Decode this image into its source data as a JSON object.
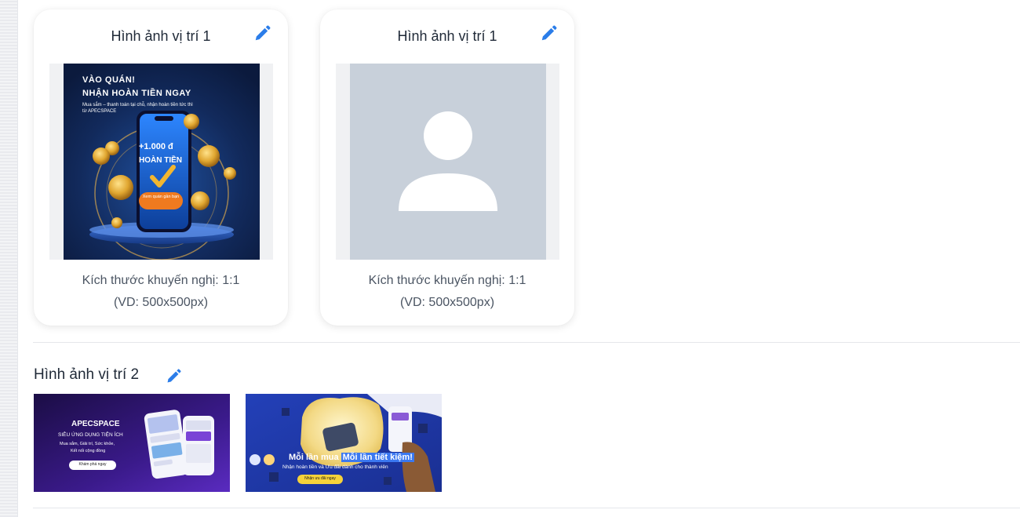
{
  "cards": [
    {
      "title": "Hình ảnh vị trí 1",
      "hint_line1": "Kích thước khuyến nghị: 1:1",
      "hint_line2": "(VD: 500x500px)",
      "image": {
        "kind": "promo",
        "headline1": "VÀO QUÁN!",
        "headline2": "NHẬN HOÀN TIỀN NGAY",
        "subtext1": "Mua sắm – thanh toán tại chỗ, nhận hoàn tiền tức thì",
        "subtext2": "từ APECSPACE",
        "phone_amount": "+1.000 đ",
        "phone_label": "HOÀN TIỀN",
        "cta": "Xem quán gần bạn"
      }
    },
    {
      "title": "Hình ảnh vị trí 1",
      "hint_line1": "Kích thước khuyến nghị: 1:1",
      "hint_line2": "(VD: 500x500px)",
      "image": {
        "kind": "placeholder-avatar"
      }
    }
  ],
  "section2": {
    "title": "Hình ảnh vị trí 2",
    "banners": [
      {
        "brand": "APECSPACE",
        "tagline": "SIÊU ỨNG DỤNG TIỆN ÍCH",
        "line1": "Mua sắm, Giải trí, Sức khỏe,",
        "line2": "Kết nối cộng đồng",
        "cta": "Khám phá ngay"
      },
      {
        "headline_part1": "Mỗi lần mua",
        "headline_part2": "Mỗi lần tiết kiệm!",
        "subline": "Nhận hoàn tiền và Ưu đãi dành cho thành viên",
        "cta": "Nhận ưu đãi ngay"
      }
    ]
  },
  "colors": {
    "accent": "#2b7de9",
    "card_bg": "#ffffff",
    "divider": "#e5e7eb",
    "placeholder_bg": "#c8d0da"
  }
}
